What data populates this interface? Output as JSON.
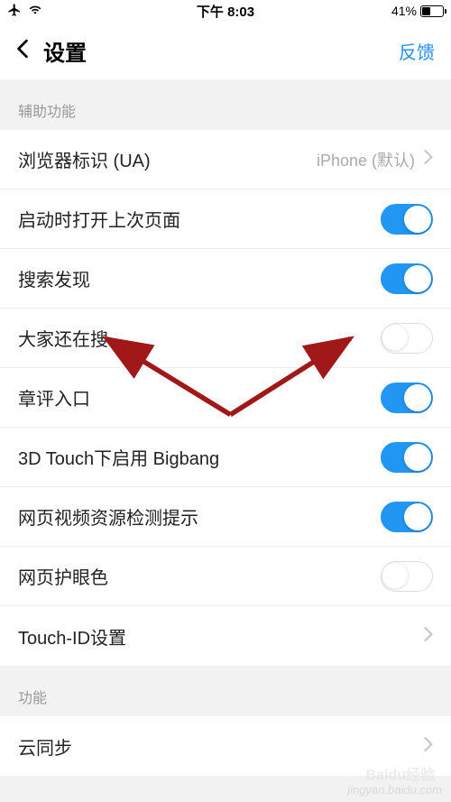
{
  "status": {
    "time": "下午 8:03",
    "battery_percent": "41%"
  },
  "nav": {
    "title": "设置",
    "feedback": "反馈"
  },
  "sections": {
    "accessibility_header": "辅助功能",
    "features_header": "功能"
  },
  "rows": {
    "ua": {
      "label": "浏览器标识 (UA)",
      "value": "iPhone (默认)"
    },
    "restore": {
      "label": "启动时打开上次页面"
    },
    "search_discover": {
      "label": "搜索发现"
    },
    "trending_search": {
      "label": "大家还在搜"
    },
    "chapter_comments": {
      "label": "章评入口"
    },
    "touch_bigbang": {
      "label": "3D Touch下启用 Bigbang"
    },
    "video_detect": {
      "label": "网页视频资源检测提示"
    },
    "eye_protect": {
      "label": "网页护眼色"
    },
    "touch_id": {
      "label": "Touch-ID设置"
    },
    "cloud_sync": {
      "label": "云同步"
    }
  },
  "watermark": {
    "line1": "Baidu经验",
    "line2": "jingyan.baidu.com"
  }
}
